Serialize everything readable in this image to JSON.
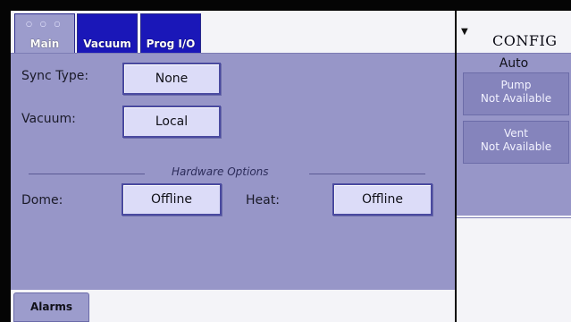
{
  "tabs": [
    {
      "label": "Main",
      "active": true,
      "indicator": "○ ○ ○"
    },
    {
      "label": "Vacuum",
      "active": false
    },
    {
      "label": "Prog I/O",
      "active": false
    }
  ],
  "main": {
    "sync_type_label": "Sync Type:",
    "sync_type_value": "None",
    "vacuum_label": "Vacuum:",
    "vacuum_value": "Local",
    "hardware_options_title": "Hardware Options",
    "dome_label": "Dome:",
    "dome_value": "Offline",
    "heat_label": "Heat:",
    "heat_value": "Offline"
  },
  "footer": {
    "alarms_label": "Alarms"
  },
  "config": {
    "title": "CONFIG",
    "mode": "Auto",
    "pump_title": "Pump",
    "pump_status": "Not Available",
    "vent_title": "Vent",
    "vent_status": "Not Available"
  },
  "colors": {
    "panel": "#9796c8",
    "active_tab": "#9c9ccc",
    "inactive_tab": "#1a17b8",
    "button": "#dcdcf8"
  }
}
